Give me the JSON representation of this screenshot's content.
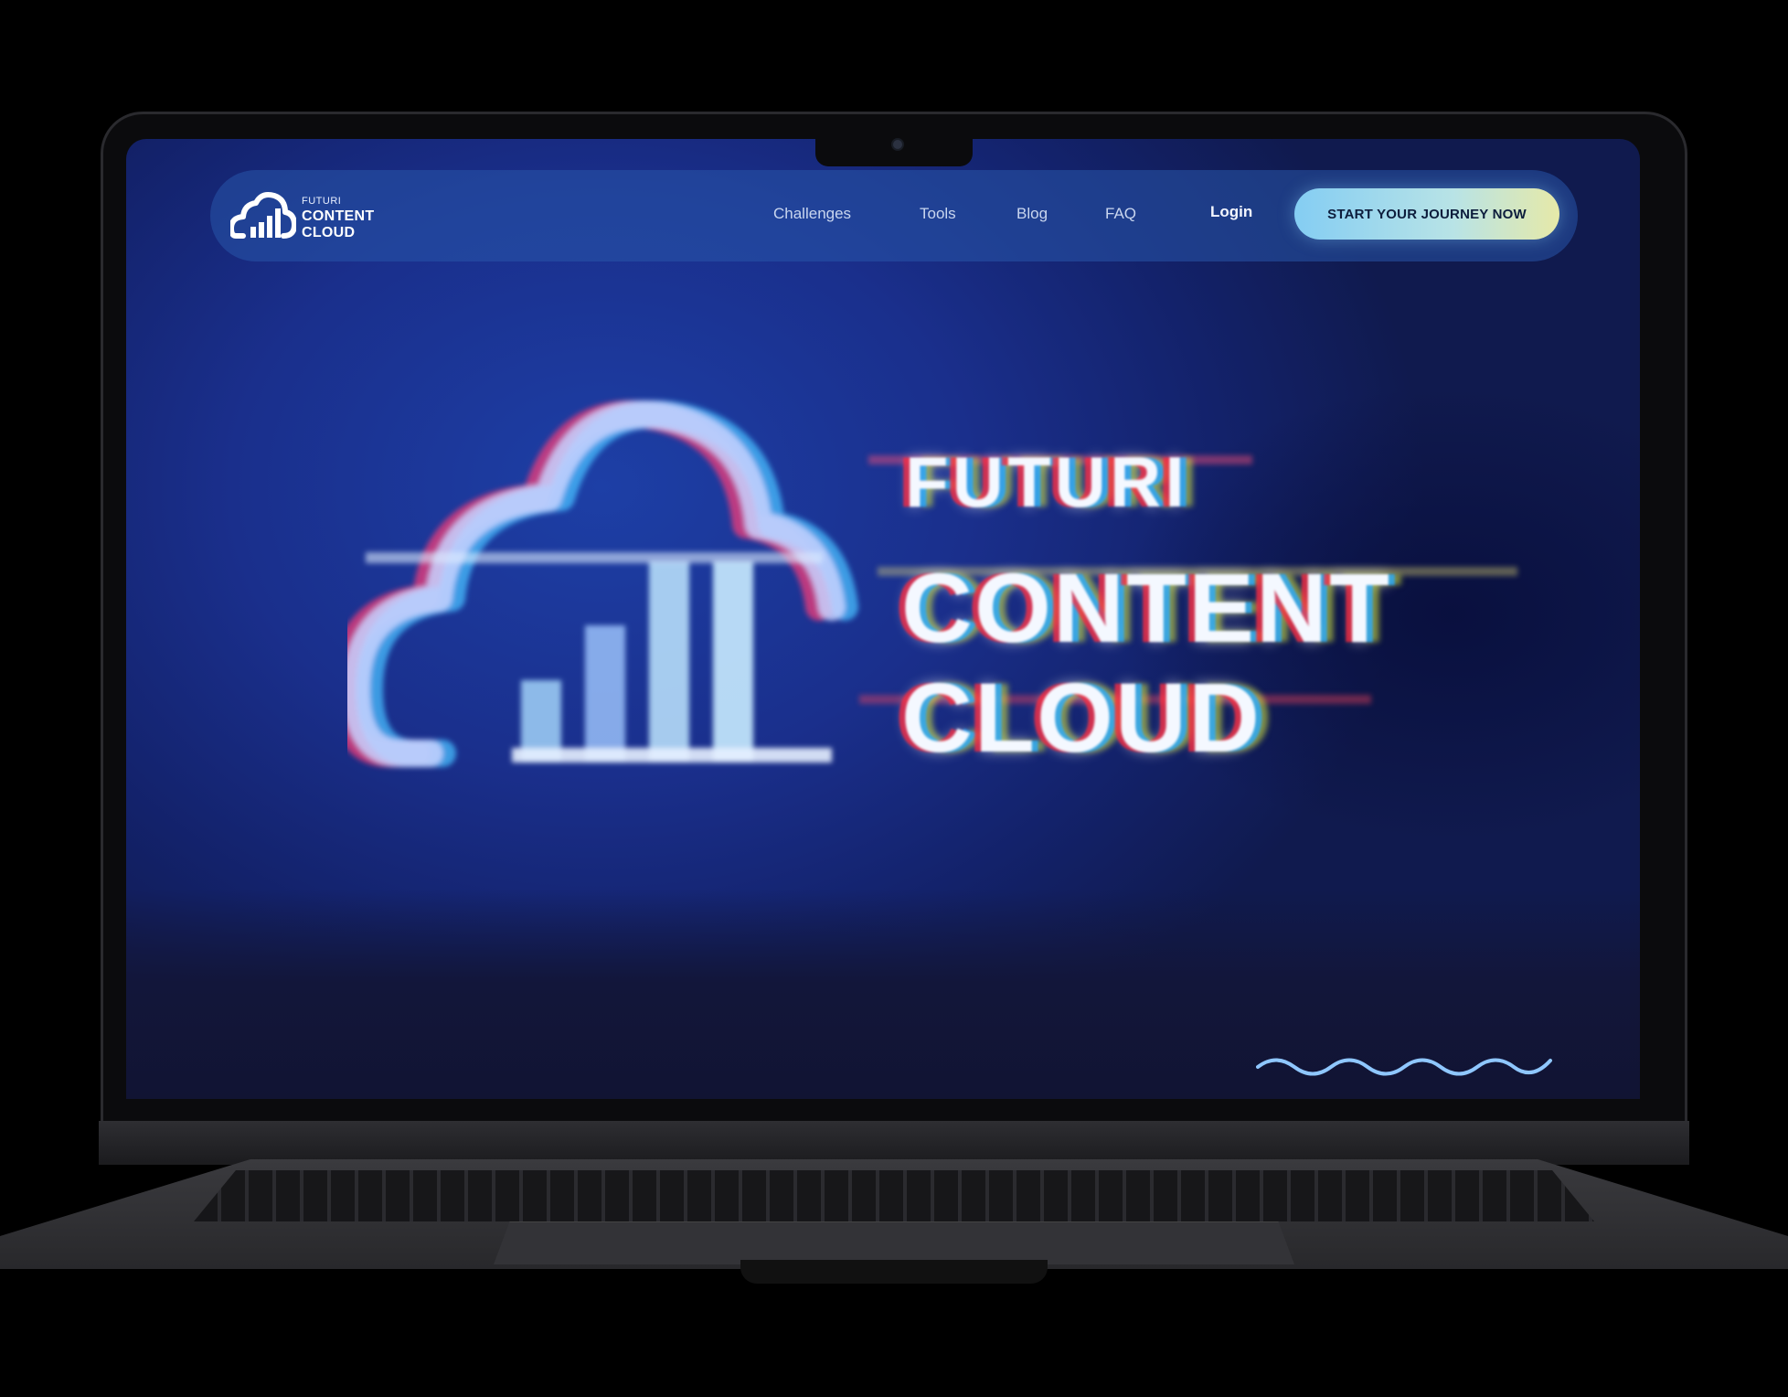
{
  "brand": {
    "line1": "FUTURI",
    "line2": "CONTENT",
    "line3": "CLOUD"
  },
  "nav": {
    "links": [
      "Challenges",
      "Tools",
      "Blog",
      "FAQ"
    ],
    "login": "Login",
    "cta": "START YOUR JOURNEY NOW"
  },
  "hero": {
    "line1": "FUTURI",
    "line2": "CONTENT",
    "line3": "CLOUD"
  },
  "colors": {
    "background": "#1a2f8c",
    "cta_start": "#84cdf3",
    "cta_end": "#e6e9a8",
    "wave": "#8fc7ff"
  },
  "icons": {
    "logo": "cloud-bars-icon",
    "decoration": "wave-icon"
  }
}
